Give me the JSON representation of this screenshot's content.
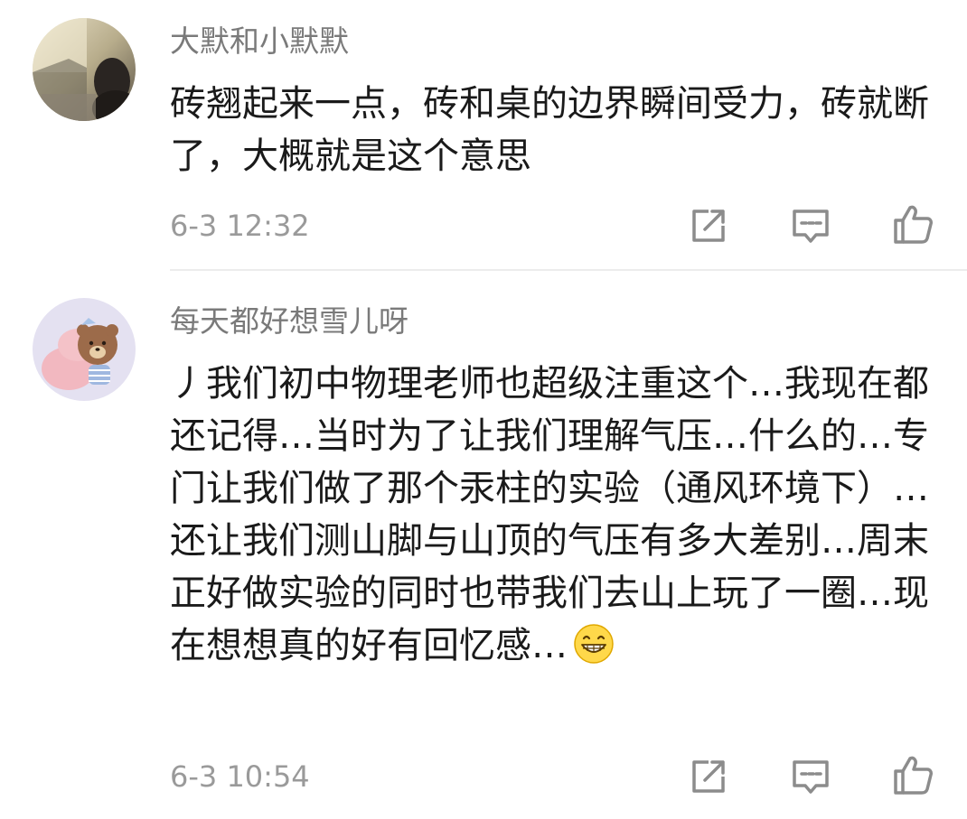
{
  "comments": [
    {
      "username": "大默和小默默",
      "text": "砖翘起来一点，砖和桌的边界瞬间受力，砖就断了，大概就是这个意思",
      "timestamp": "6-3 12:32",
      "actions": [
        "share-icon",
        "reply-icon",
        "like-icon"
      ]
    },
    {
      "username": "每天都好想雪儿呀",
      "text": "丿我们初中物理老师也超级注重这个…我现在都还记得…当时为了让我们理解气压…什么的…专门让我们做了那个汞柱的实验（通风环境下）…还让我们测山脚与山顶的气压有多大差别…周末正好做实验的同时也带我们去山上玩了一圈…现在想想真的好有回忆感…",
      "emoji": "grinning-face-emoji",
      "timestamp": "6-3 10:54",
      "actions": [
        "share-icon",
        "reply-icon",
        "like-icon"
      ]
    }
  ],
  "colors": {
    "username": "#7a7a7a",
    "body_text": "#1a1a1a",
    "timestamp": "#9a9a9a",
    "icon": "#8c8c8c",
    "divider": "#ececec"
  }
}
